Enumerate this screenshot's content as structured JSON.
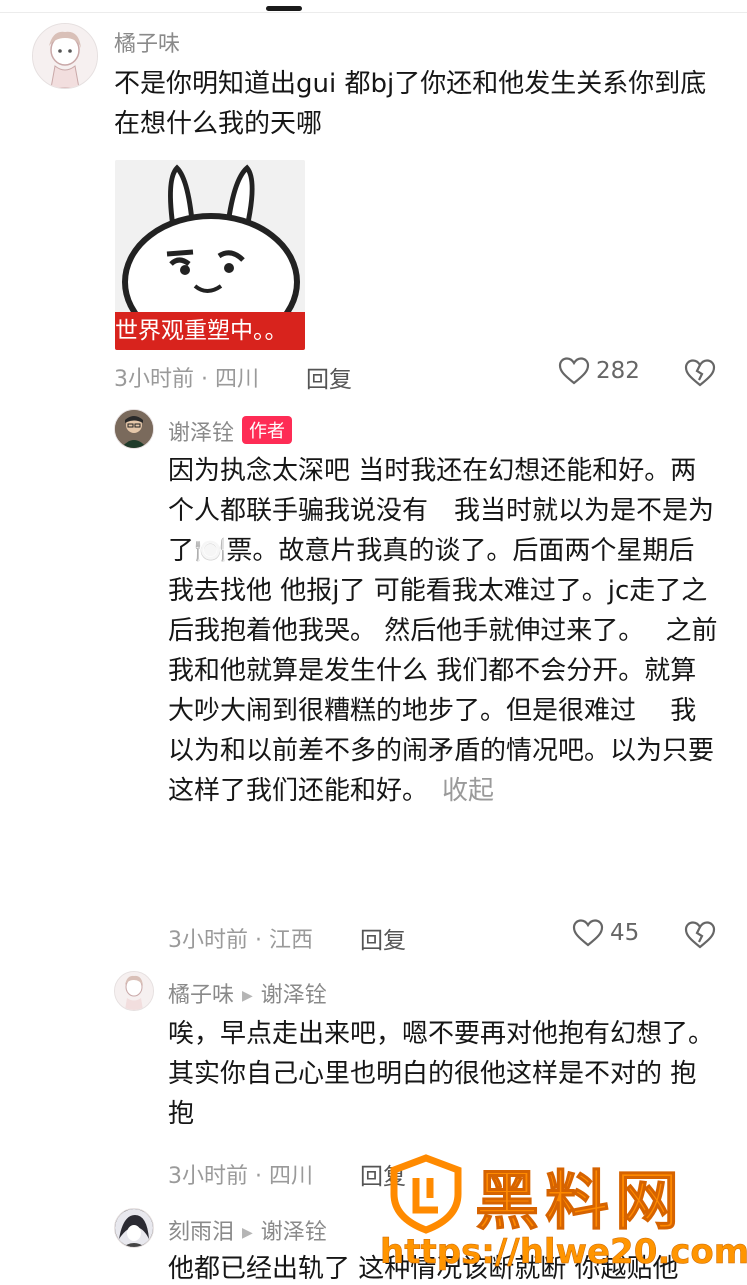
{
  "comments": [
    {
      "user": "橘子味",
      "text": "不是你明知道出gui 都bj了你还和他发生关系你到底在想什么我的天哪",
      "sticker_caption": "世界观重塑中。。",
      "meta": "3小时前 · 四川",
      "reply_label": "回复",
      "likes": "282"
    },
    {
      "user": "谢泽铨",
      "author_tag": "作者",
      "text": "因为执念太深吧 当时我还在幻想还能和好。两个人都联手骗我说没有　我当时就以为是不是为了🍽️票。故意片我真的谈了。后面两个星期后我去找他 他报j了 可能看我太难过了。jc走了之后我抱着他我哭。 然后他手就伸过来了。　 之前我和他就算是发生什么 我们都不会分开。就算大吵大闹到很糟糕的地步了。但是很难过　 我以为和以前差不多的闹矛盾的情况吧。以为只要这样了我们还能和好。",
      "fold_label": "收起",
      "meta": "3小时前 · 江西",
      "reply_label": "回复",
      "likes": "45"
    },
    {
      "user": "橘子味",
      "reply_to": "谢泽铨",
      "text": "唉，早点走出来吧，嗯不要再对他抱有幻想了。其实你自己心里也明白的很他这样是不对的 抱抱",
      "meta": "3小时前 · 四川",
      "reply_label": "回复"
    },
    {
      "user": "刻雨泪",
      "reply_to": "谢泽铨",
      "text": "他都已经出轨了 这种情况该断就断 你越贴他"
    }
  ],
  "watermark": {
    "title": "黑料网",
    "url": "https://hlwe20.com"
  },
  "colors": {
    "author_tag": "#fe2c55",
    "watermark": "#ff8a00",
    "sticker_caption_bg": "#d8231d"
  }
}
